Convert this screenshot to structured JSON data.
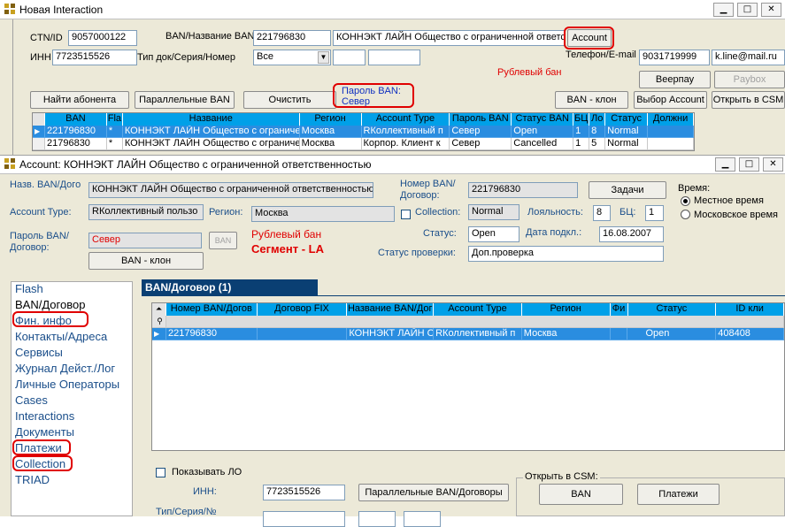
{
  "win1": {
    "title": "Новая Interaction",
    "ctn_label": "CTN/ID",
    "ctn_value": "9057000122",
    "ban_name_label": "BAN/Название BAN",
    "ban_value": "221796830",
    "ban_name_value": "КОННЭКТ ЛАЙН Общество с ограниченной ответст",
    "account_button": "Account",
    "inn_label": "ИНН",
    "inn_value": "7723515526",
    "doctype_label": "Тип док/Серия/Номер",
    "doctype_value": "Все",
    "phone_email_label": "Телефон/E-mail",
    "phone_value": "9031719999",
    "email_value": "k.line@mail.ru",
    "ruble_ban": "Рублевый бан",
    "veerpay_button": "Веерпау",
    "paybox_button": "Paybox",
    "buttons": {
      "find": "Найти абонента",
      "parallel": "Параллельные BAN",
      "clear": "Очистить",
      "ban_clone": "BAN - клон",
      "choose_account": "Выбор Account",
      "open_csm": "Открыть в CSM"
    },
    "password_label": "Пароль BAN:",
    "password_value": "Север",
    "table": {
      "headers": [
        "BAN",
        "Fla",
        "Название",
        "Регион",
        "Account Type",
        "Пароль BAN",
        "Статус BAN",
        "БЦ",
        "Ло",
        "Статус",
        "Должни"
      ],
      "rows": [
        [
          "221796830",
          "*",
          "КОННЭКТ ЛАЙН Общество с ограниче",
          "Москва",
          "RКоллективный п",
          "Север",
          "Open",
          "1",
          "8",
          "Normal",
          ""
        ],
        [
          "21796830",
          "*",
          "КОННЭКТ ЛАЙН Общество с ограниче",
          "Москва",
          "Корпор. Клиент к",
          "Север",
          "Cancelled",
          "1",
          "5",
          "Normal",
          ""
        ]
      ]
    }
  },
  "win2": {
    "title": "Account: КОННЭКТ ЛАЙН Общество с ограниченной ответственностью",
    "name_label": "Назв. BAN/Дого",
    "name_value": "КОННЭКТ ЛАЙН Общество с ограниченной ответственностью",
    "number_label_1": "Номер BAN/",
    "number_label_2": "Договор:",
    "number_value": "221796830",
    "tasks_button": "Задачи",
    "time_label": "Время:",
    "time_local": "Местное время",
    "time_moscow": "Московское время",
    "account_type_label": "Account Type:",
    "account_type_value": "RКоллективный пользо",
    "region_label": "Регион:",
    "region_value": "Москва",
    "collection_label": "Collection:",
    "collection_value": "Normal",
    "loyalty_label": "Лояльность:",
    "loyalty_value": "8",
    "bc_label": "БЦ:",
    "bc_value": "1",
    "pass_label_1": "Пароль BAN/",
    "pass_label_2": "Договор:",
    "pass_value": "Север",
    "ban_small_button": "BAN",
    "ruble_ban": "Рублевый бан",
    "segment": "Сегмент - LA",
    "status_label": "Статус:",
    "status_value": "Open",
    "date_label": "Дата подкл.:",
    "date_value": "16.08.2007",
    "check_status_label": "Статус проверки:",
    "check_status_value": "Доп.проверка",
    "ban_clone_button": "BAN - клон",
    "sidebar": [
      "Flash",
      "BAN/Договор",
      "Фин. инфо",
      "Контакты/Адреса",
      "Сервисы",
      "Журнал Дейст./Лог",
      "Личные Операторы",
      "Cases",
      "Interactions",
      "Документы",
      "Платежи",
      "Collection",
      "TRIAD"
    ],
    "tab_title": "BAN/Договор (1)",
    "grid": {
      "headers": [
        "Номер BAN/Догов",
        "Договор FIX",
        "Название BAN/Дог",
        "Account Type",
        "Регион",
        "Фи",
        "Статус",
        "ID кли"
      ],
      "row": [
        "221796830",
        "",
        "КОННЭКТ ЛАЙН О",
        "RКоллективный п",
        "Москва",
        "",
        "Open",
        "408408"
      ]
    },
    "show_lo": "Показывать ЛО",
    "inn_label": "ИНН:",
    "inn_value": "7723515526",
    "parallel_button": "Параллельные BAN/Договоры",
    "open_csm_label": "Открыть в CSM:",
    "csm_ban_button": "BAN",
    "csm_payments_button": "Платежи",
    "doc_series_label": "Тип/Серия/№"
  }
}
